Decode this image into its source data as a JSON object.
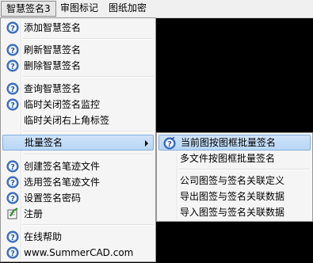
{
  "menubar": {
    "items": [
      "智慧签名3",
      "审图标记",
      "图纸加密"
    ]
  },
  "menu": {
    "items": [
      {
        "label": "添加智慧签名",
        "icon": "help-icon"
      },
      {
        "label": "刷新智慧签名",
        "icon": "help-icon"
      },
      {
        "label": "删除智慧签名",
        "icon": "help-icon"
      },
      {
        "label": "查询智慧签名",
        "icon": "help-icon"
      },
      {
        "label": "临时关闭签名监控",
        "icon": "help-icon"
      },
      {
        "label": "临时关闭右上角标签",
        "icon": ""
      },
      {
        "label": "批量签名",
        "icon": "",
        "submenu": true
      },
      {
        "label": "创建签名笔迹文件",
        "icon": "help-icon"
      },
      {
        "label": "选用签名笔迹文件",
        "icon": "help-icon"
      },
      {
        "label": "设置签名密码",
        "icon": "help-icon"
      },
      {
        "label": "注册",
        "icon": "register-icon"
      },
      {
        "label": "在线帮助",
        "icon": "help-icon"
      },
      {
        "label": "www.SummerCAD.com",
        "icon": "help-icon"
      }
    ]
  },
  "submenu": {
    "items": [
      {
        "label": "当前图按图框批量签名",
        "icon": "batch-sign-icon"
      },
      {
        "label": "多文件按图框批量签名",
        "icon": ""
      },
      {
        "label": "公司图签与签名关联定义",
        "icon": ""
      },
      {
        "label": "导出图签与签名关联数据",
        "icon": ""
      },
      {
        "label": "导入图签与签名关联数据",
        "icon": ""
      }
    ]
  }
}
